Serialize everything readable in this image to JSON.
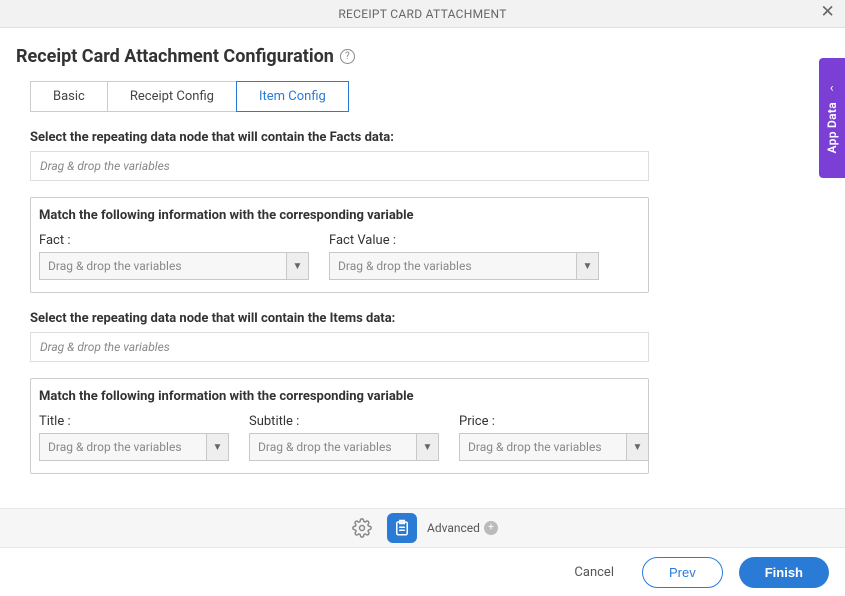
{
  "titlebar": {
    "title": "RECEIPT CARD ATTACHMENT"
  },
  "page": {
    "heading": "Receipt Card Attachment Configuration"
  },
  "tabs": [
    {
      "label": "Basic",
      "active": false
    },
    {
      "label": "Receipt Config",
      "active": false
    },
    {
      "label": "Item Config",
      "active": true
    }
  ],
  "facts": {
    "select_label": "Select the repeating data node that will contain the Facts data:",
    "drop_placeholder": "Drag & drop the variables",
    "match_title": "Match the following information with the corresponding variable",
    "cols": {
      "fact_label": "Fact :",
      "fact_placeholder": "Drag & drop the variables",
      "factvalue_label": "Fact Value :",
      "factvalue_placeholder": "Drag & drop the variables"
    }
  },
  "items": {
    "select_label": "Select the repeating data node that will contain the Items data:",
    "drop_placeholder": "Drag & drop the variables",
    "match_title": "Match the following information with the corresponding variable",
    "cols": {
      "title_label": "Title :",
      "title_placeholder": "Drag & drop the variables",
      "subtitle_label": "Subtitle :",
      "subtitle_placeholder": "Drag & drop the variables",
      "price_label": "Price :",
      "price_placeholder": "Drag & drop the variables"
    }
  },
  "side_tab": {
    "label": "App Data"
  },
  "toolbar": {
    "advanced_label": "Advanced"
  },
  "footer": {
    "cancel": "Cancel",
    "prev": "Prev",
    "finish": "Finish"
  }
}
